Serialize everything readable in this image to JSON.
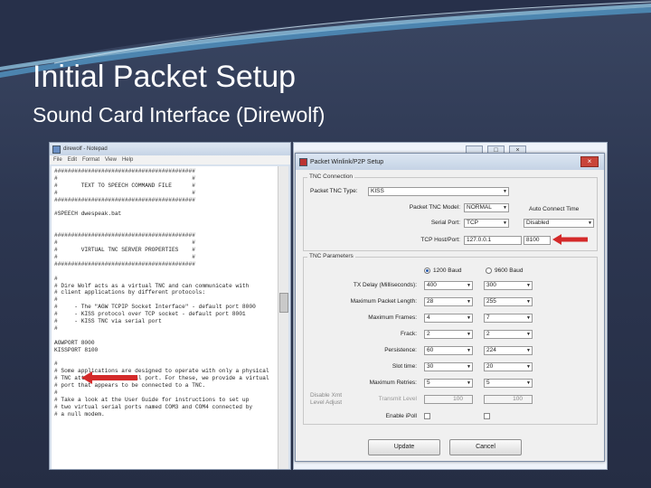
{
  "slide": {
    "title": "Initial Packet Setup",
    "subtitle": "Sound Card Interface (Direwolf)"
  },
  "notepad": {
    "window_title": "direwolf - Notepad",
    "menu": [
      "File",
      "Edit",
      "Format",
      "View",
      "Help"
    ],
    "content": "##########################################\n#                                        #\n#       TEXT TO SPEECH COMMAND FILE      #\n#                                        #\n##########################################\n\n#SPEECH dwespeak.bat\n\n\n##########################################\n#                                        #\n#       VIRTUAL TNC SERVER PROPERTIES    #\n#                                        #\n##########################################\n\n#\n# Dire Wolf acts as a virtual TNC and can communicate with\n# client applications by different protocols:\n#\n#     - The \"AGW TCPIP Socket Interface\" - default port 8000\n#     - KISS protocol over TCP socket - default port 8001\n#     - KISS TNC via serial port\n#\n\nAGWPORT 8000\nKISSPORT 8100\n\n#\n# Some applications are designed to operate with only a physical\n# TNC attached to a serial port. For these, we provide a virtual\n# port that appears to be connected to a TNC.\n#\n# Take a look at the User Guide for instructions to set up\n# two virtual serial ports named COM3 and COM4 connected by\n# a null modem."
  },
  "bgwindow": {
    "controls": [
      "_",
      "□",
      "×"
    ]
  },
  "dialog": {
    "title": "Packet Winlink/P2P Setup",
    "close": "×",
    "tnc_connection": {
      "group_label": "TNC Connection",
      "type_label": "Packet TNC Type:",
      "type_value": "KISS",
      "model_label": "Packet TNC Model:",
      "model_value": "NORMAL",
      "autoconnect_label": "Auto Connect Time",
      "serial_label": "Serial Port:",
      "serial_value": "TCP",
      "autoconnect_value": "Disabled",
      "tcp_label": "TCP Host/Port:",
      "tcp_host": "127.0.0.1",
      "tcp_port": "8100"
    },
    "tnc_parameters": {
      "group_label": "TNC Parameters",
      "baud_1200": "1200 Baud",
      "baud_9600": "9600 Baud",
      "rows": [
        {
          "label": "TX Delay (Milliseconds):",
          "v1": "400",
          "v2": "300"
        },
        {
          "label": "Maximum Packet Length:",
          "v1": "28",
          "v2": "255"
        },
        {
          "label": "Maximum Frames:",
          "v1": "4",
          "v2": "7"
        },
        {
          "label": "Frack:",
          "v1": "2",
          "v2": "2"
        },
        {
          "label": "Persistence:",
          "v1": "60",
          "v2": "224"
        },
        {
          "label": "Slot time:",
          "v1": "30",
          "v2": "20"
        },
        {
          "label": "Maximum Retries:",
          "v1": "5",
          "v2": "5"
        }
      ],
      "disable_xmt_label": "Disable Xmt",
      "level_adjust_label": "Level Adjust",
      "level_label": "Transmit Level",
      "level_v1": "100",
      "level_v2": "100",
      "enable_poll_label": "Enable iPoll"
    },
    "buttons": {
      "update": "Update",
      "cancel": "Cancel"
    }
  },
  "colors": {
    "background": "#2c3650",
    "arrow": "#d42a2a",
    "swoosh": "#4f8cb8"
  }
}
